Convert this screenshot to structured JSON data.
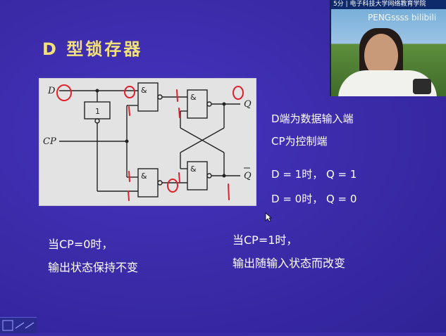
{
  "slide": {
    "title": "D 型锁存器",
    "circuit": {
      "inputs": [
        "D",
        "CP"
      ],
      "outputs": [
        "Q",
        "Q"
      ],
      "inverter_label": "1",
      "gate_labels": [
        "&",
        "&",
        "&",
        "&"
      ],
      "annotation_color": "#e0202a"
    },
    "right_text": {
      "line1": "D端为数据输入端",
      "line2": "CP为控制端",
      "line3": "D = 1时， Q = 1",
      "line4": "D = 0时， Q = 0"
    },
    "bottom_left": {
      "line1": "当CP=0时，",
      "line2": "输出状态保持不变"
    },
    "bottom_right": {
      "line1": "当CP=1时，",
      "line2": "输出随输入状态而改变"
    }
  },
  "video_overlay": {
    "top_text": "5分 | 电子科技大学网络教育学院",
    "watermark": "PENGssss bilibili"
  },
  "colors": {
    "background": "#3a2aa6",
    "title": "#f2e07a",
    "text": "#ffffff"
  }
}
